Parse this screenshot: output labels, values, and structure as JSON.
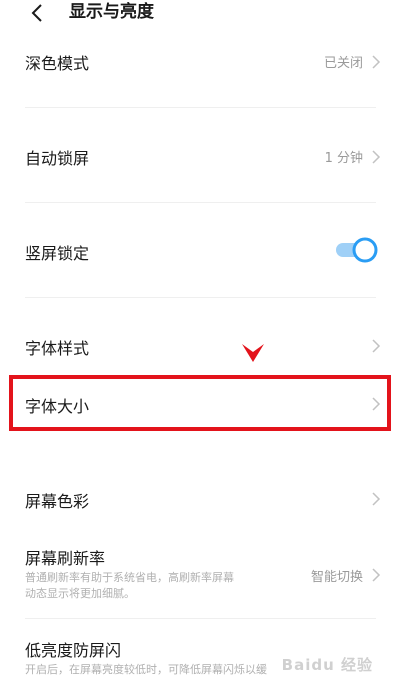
{
  "header": {
    "title": "显示与亮度"
  },
  "settings": {
    "dark_mode": {
      "label": "深色模式",
      "value": "已关闭"
    },
    "auto_lock": {
      "label": "自动锁屏",
      "value": "1 分钟"
    },
    "portrait_lock": {
      "label": "竖屏锁定",
      "enabled": true
    },
    "font_style": {
      "label": "字体样式"
    },
    "font_size": {
      "label": "字体大小"
    },
    "screen_color": {
      "label": "屏幕色彩"
    },
    "refresh_rate": {
      "label": "屏幕刷新率",
      "value": "智能切换",
      "description_line1": "普通刷新率有助于系统省电，高刷新率屏幕",
      "description_line2": "动态显示将更加细腻。"
    },
    "low_brightness_flicker": {
      "label": "低亮度防屏闪",
      "description": "开启后，在屏幕亮度较低时，可降低屏幕闪烁以缓"
    }
  },
  "watermark": {
    "text": "Baidu 经验"
  },
  "colors": {
    "accent": "#2a9df4",
    "highlight": "#e3131b",
    "text_primary": "#1a1a1a",
    "text_secondary": "#9a9a9a"
  }
}
